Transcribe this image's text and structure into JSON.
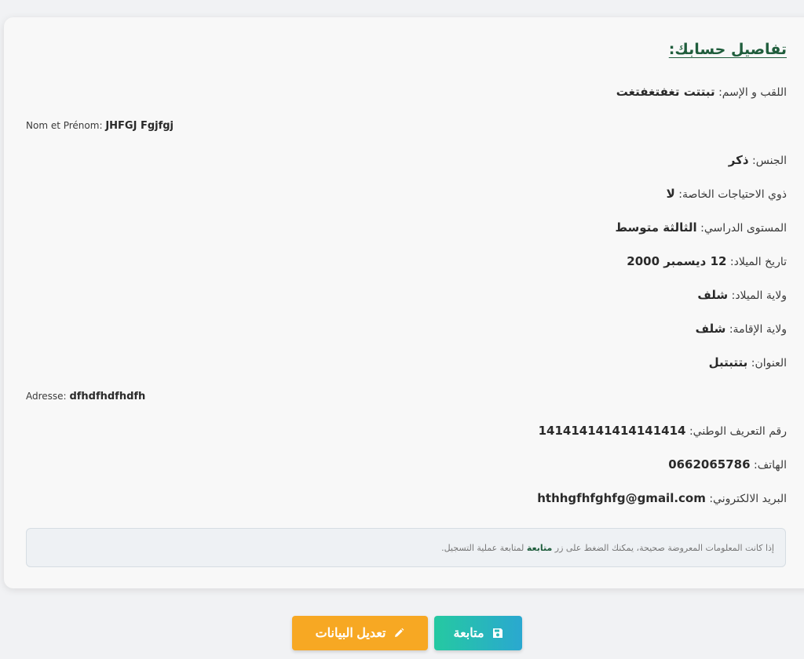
{
  "title": "تفاصيل حسابك:",
  "fields": {
    "fullname_ar": {
      "label": "اللقب و الإسم:",
      "value": "تبتتت تغفتغفتغت"
    },
    "fullname_fr": {
      "label": "Nom et Prénom:",
      "value": "JHFGJ Fgjfgj"
    },
    "gender": {
      "label": "الجنس:",
      "value": "ذكر"
    },
    "special_needs": {
      "label": "ذوي الاحتياجات الخاصة:",
      "value": "لا"
    },
    "level": {
      "label": "المستوى الدراسي:",
      "value": "الثالثة متوسط"
    },
    "birth_date": {
      "label": "تاريخ الميلاد:",
      "value": "12 ديسمبر 2000"
    },
    "birth_state": {
      "label": "ولاية الميلاد:",
      "value": "شلف"
    },
    "residence_state": {
      "label": "ولاية الإقامة:",
      "value": "شلف"
    },
    "address_ar": {
      "label": "العنوان:",
      "value": "بتتبتبل"
    },
    "address_fr": {
      "label": "Adresse:",
      "value": "dfhdfhdfhdfh"
    },
    "national_id": {
      "label": "رقم التعريف الوطني:",
      "value": "141414141414141414"
    },
    "phone": {
      "label": "الهاتف:",
      "value": "0662065786"
    },
    "email": {
      "label": "البريد الالكتروني:",
      "value": "hthhgfhfghfg@gmail.com"
    }
  },
  "note": {
    "before": "إذا كانت المعلومات المعروضة صحيحة، يمكنك الضغط على زر",
    "highlight": "متابعة",
    "after": "لمتابعة عملية التسجيل."
  },
  "buttons": {
    "continue_label": "متابعة",
    "continue_icon": "save-icon",
    "edit_label": "تعديل البيانات",
    "edit_icon": "pencil-icon"
  },
  "colors": {
    "accent_green": "#1f5d3c",
    "edit_button": "#f7a823",
    "continue_button": "#25c9a1"
  }
}
